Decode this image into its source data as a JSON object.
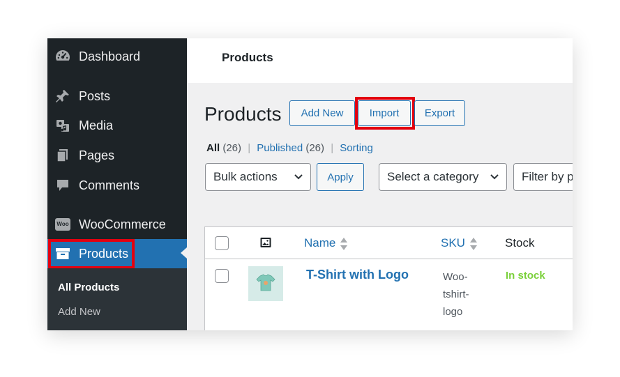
{
  "sidebar": {
    "items": [
      {
        "label": "Dashboard",
        "icon": "dashboard-icon"
      },
      {
        "label": "Posts",
        "icon": "pin-icon"
      },
      {
        "label": "Media",
        "icon": "media-icon"
      },
      {
        "label": "Pages",
        "icon": "pages-icon"
      },
      {
        "label": "Comments",
        "icon": "comment-icon"
      },
      {
        "label": "WooCommerce",
        "icon": "woocommerce-icon",
        "badge": "Woo"
      },
      {
        "label": "Products",
        "icon": "archive-icon"
      }
    ],
    "submenu": [
      {
        "label": "All Products"
      },
      {
        "label": "Add New"
      }
    ]
  },
  "header": {
    "title": "Products"
  },
  "page": {
    "title": "Products",
    "actions": {
      "add_new": "Add New",
      "import": "Import",
      "export": "Export"
    }
  },
  "filters": {
    "all_label": "All",
    "all_count": "(26)",
    "published_label": "Published",
    "published_count": "(26)",
    "sorting_label": "Sorting",
    "separator": "|"
  },
  "toolbar": {
    "bulk_actions": "Bulk actions",
    "apply": "Apply",
    "category": "Select a category",
    "filter_type": "Filter by product type"
  },
  "table": {
    "columns": {
      "name": "Name",
      "sku": "SKU",
      "stock": "Stock"
    },
    "rows": [
      {
        "name": "T-Shirt with Logo",
        "sku_lines": [
          "Woo-",
          "tshirt-",
          "logo"
        ],
        "stock": "In stock"
      }
    ]
  },
  "colors": {
    "accent": "#2271b1",
    "sidebar_bg": "#1d2327",
    "highlight": "#e3000f",
    "in_stock": "#7ad03a"
  }
}
